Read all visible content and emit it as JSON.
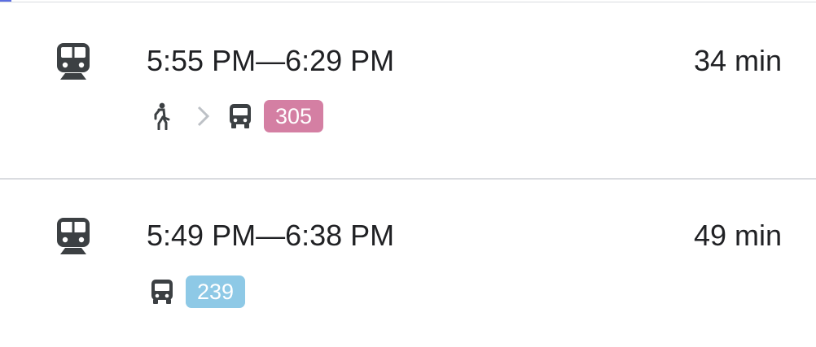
{
  "routes": [
    {
      "times": "5:55 PM—6:29 PM",
      "duration": "34 min",
      "mode_icon": "train-icon",
      "steps": [
        "walk-icon",
        "chevron-right-icon",
        "bus-icon"
      ],
      "bus_line": "305",
      "badge_color": "#d47fa3"
    },
    {
      "times": "5:49 PM—6:38 PM",
      "duration": "49 min",
      "mode_icon": "train-icon",
      "steps": [
        "bus-icon"
      ],
      "bus_line": "239",
      "badge_color": "#8ec9e6"
    }
  ],
  "colors": {
    "text": "#202124",
    "icon": "#3c4043",
    "divider": "#dadce0",
    "chevron": "#bdc1c6"
  }
}
